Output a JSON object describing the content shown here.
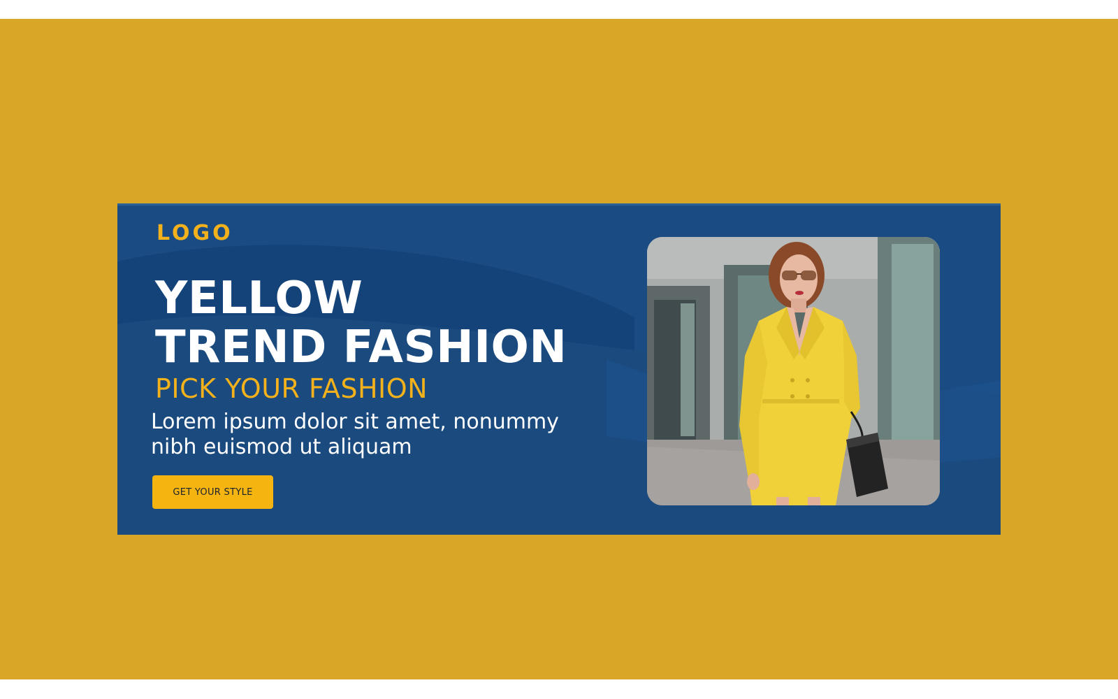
{
  "banner": {
    "logo": "LOGO",
    "headline_line1": "YELLOW",
    "headline_line2": "TREND FASHION",
    "tagline": "PICK YOUR FASHION",
    "body_line1": "Lorem ipsum dolor sit amet, nonummy",
    "body_line2": "nibh euismod ut aliquam",
    "cta_label": "GET YOUR STYLE",
    "photo_alt": "Woman in a yellow blazer dress with sunglasses and a black handbag"
  },
  "colors": {
    "background": "#d9a627",
    "banner": "#1a4c83",
    "accent": "#f3b21c",
    "button": "#f5b40f",
    "text": "#ffffff"
  }
}
